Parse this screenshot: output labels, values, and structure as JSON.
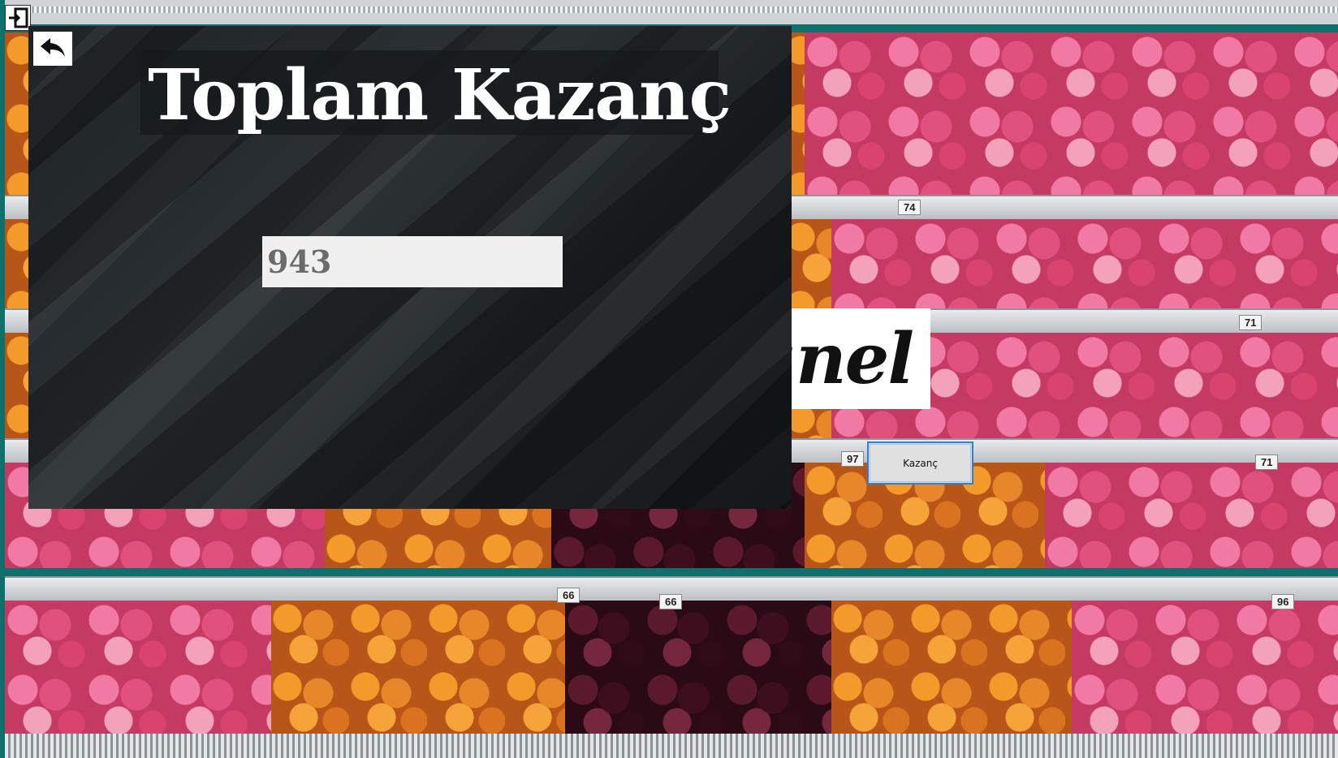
{
  "window": {
    "icon": "exit-door-icon"
  },
  "background": {
    "brand_sign_text": "anel",
    "price_tags": [
      "74",
      "71",
      "97",
      "71",
      "66",
      "66",
      "96"
    ]
  },
  "form": {
    "kazanc_button_label": "Kazanç"
  },
  "panel": {
    "back_icon": "back-arrow-icon",
    "title": "Toplam Kazanç",
    "total_value": "943"
  },
  "colors": {
    "panel_bg": "#1e2326",
    "title_text": "#ffffff",
    "input_bg": "#f0f0f0",
    "input_text": "#6b6b6b",
    "button_border": "#2f7fd8",
    "window_frame": "#0f6f6a"
  }
}
